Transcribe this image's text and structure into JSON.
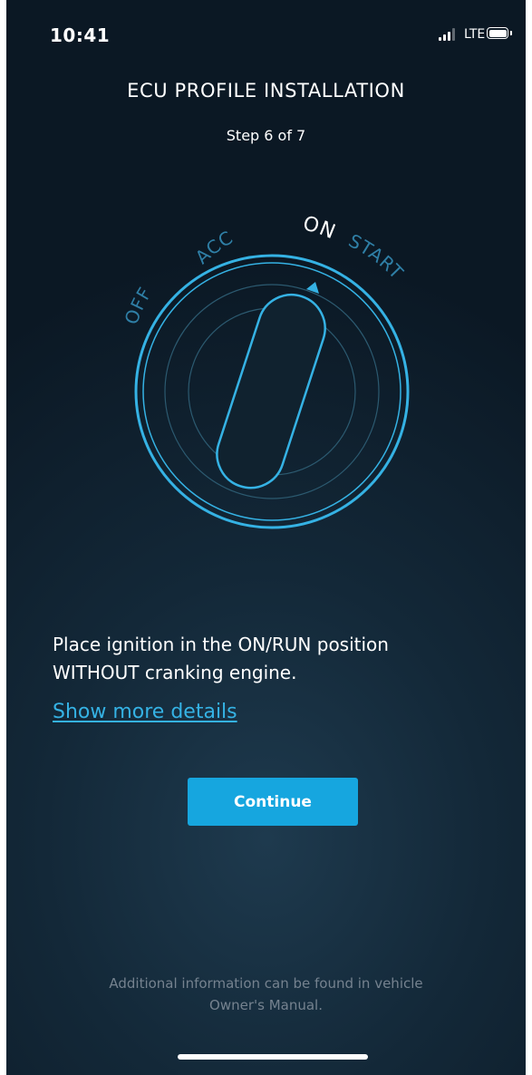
{
  "status_bar": {
    "time": "10:41",
    "network": "LTE",
    "battery_level": 1.0
  },
  "header": {
    "title": "ECU PROFILE INSTALLATION",
    "step": "Step 6 of 7"
  },
  "ignition": {
    "positions": [
      "OFF",
      "ACC",
      "ON",
      "START"
    ],
    "selected": "ON",
    "colors": {
      "active": "#35b2e4",
      "inactive": "#2f7fa6",
      "ring_inner": "#2c5a70"
    }
  },
  "content": {
    "instruction_line1": "Place ignition in the ON/RUN position",
    "instruction_line2": "WITHOUT cranking engine.",
    "details_link": "Show more details",
    "continue_label": "Continue",
    "footer_line1": "Additional information can be found in vehicle",
    "footer_line2": "Owner's Manual."
  },
  "colors": {
    "accent": "#16a6df",
    "link": "#35b2e4",
    "background": "#0f2231"
  }
}
